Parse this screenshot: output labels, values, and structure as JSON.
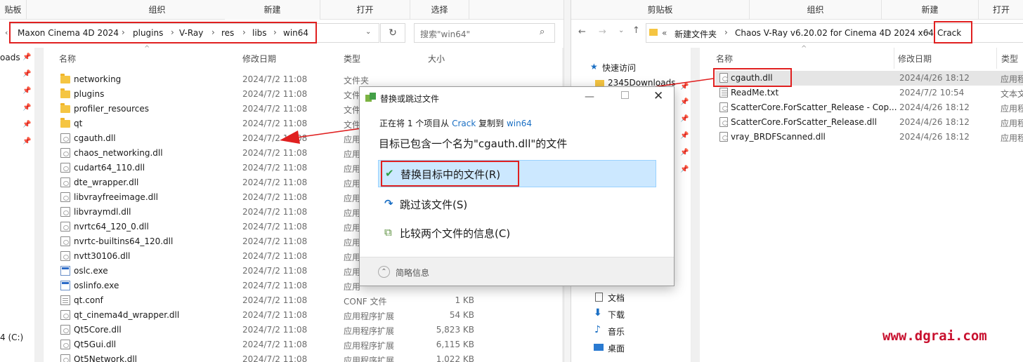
{
  "left": {
    "ribbon": [
      "贴板",
      "组织",
      "新建",
      "打开",
      "选择"
    ],
    "path": [
      "Maxon Cinema 4D 2024",
      "plugins",
      "V-Ray",
      "res",
      "libs",
      "win64"
    ],
    "search_placeholder": "搜索\"win64\"",
    "columns": {
      "name": "名称",
      "date": "修改日期",
      "type": "类型",
      "size": "大小"
    },
    "nav": {
      "downloads": "oads",
      "drive": "4 (C:)"
    },
    "files": [
      {
        "name": "networking",
        "date": "2024/7/2 11:08",
        "type": "文件夹",
        "size": "",
        "icon": "folder"
      },
      {
        "name": "plugins",
        "date": "2024/7/2 11:08",
        "type": "文件",
        "size": "",
        "icon": "folder"
      },
      {
        "name": "profiler_resources",
        "date": "2024/7/2 11:08",
        "type": "文件",
        "size": "",
        "icon": "folder"
      },
      {
        "name": "qt",
        "date": "2024/7/2 11:08",
        "type": "文件",
        "size": "",
        "icon": "folder"
      },
      {
        "name": "cgauth.dll",
        "date": "2024/7/2 11:08",
        "type": "应用",
        "size": "",
        "icon": "dll"
      },
      {
        "name": "chaos_networking.dll",
        "date": "2024/7/2 11:08",
        "type": "应用",
        "size": "",
        "icon": "dll"
      },
      {
        "name": "cudart64_110.dll",
        "date": "2024/7/2 11:08",
        "type": "应用",
        "size": "",
        "icon": "dll"
      },
      {
        "name": "dte_wrapper.dll",
        "date": "2024/7/2 11:08",
        "type": "应用",
        "size": "",
        "icon": "dll"
      },
      {
        "name": "libvrayfreeimage.dll",
        "date": "2024/7/2 11:08",
        "type": "应用",
        "size": "",
        "icon": "dll"
      },
      {
        "name": "libvraymdl.dll",
        "date": "2024/7/2 11:08",
        "type": "应用",
        "size": "",
        "icon": "dll"
      },
      {
        "name": "nvrtc64_120_0.dll",
        "date": "2024/7/2 11:08",
        "type": "应用",
        "size": "",
        "icon": "dll"
      },
      {
        "name": "nvrtc-builtins64_120.dll",
        "date": "2024/7/2 11:08",
        "type": "应用",
        "size": "",
        "icon": "dll"
      },
      {
        "name": "nvtt30106.dll",
        "date": "2024/7/2 11:08",
        "type": "应用",
        "size": "",
        "icon": "dll"
      },
      {
        "name": "oslc.exe",
        "date": "2024/7/2 11:08",
        "type": "应用",
        "size": "",
        "icon": "exe"
      },
      {
        "name": "oslinfo.exe",
        "date": "2024/7/2 11:08",
        "type": "应用",
        "size": "",
        "icon": "exe"
      },
      {
        "name": "qt.conf",
        "date": "2024/7/2 11:08",
        "type": "CONF 文件",
        "size": "1 KB",
        "icon": "txt"
      },
      {
        "name": "qt_cinema4d_wrapper.dll",
        "date": "2024/7/2 11:08",
        "type": "应用程序扩展",
        "size": "54 KB",
        "icon": "dll"
      },
      {
        "name": "Qt5Core.dll",
        "date": "2024/7/2 11:08",
        "type": "应用程序扩展",
        "size": "5,823 KB",
        "icon": "dll"
      },
      {
        "name": "Qt5Gui.dll",
        "date": "2024/7/2 11:08",
        "type": "应用程序扩展",
        "size": "6,115 KB",
        "icon": "dll"
      },
      {
        "name": "Qt5Network.dll",
        "date": "2024/7/2 11:08",
        "type": "应用程序扩展",
        "size": "1,022 KB",
        "icon": "dll"
      }
    ]
  },
  "right": {
    "ribbon": [
      "剪贴板",
      "组织",
      "新建",
      "打开"
    ],
    "path_prefix": "«",
    "path": [
      "新建文件夹",
      "Chaos V-Ray v6.20.02 for Cinema 4D 2024 x64",
      "Crack"
    ],
    "columns": {
      "name": "名称",
      "date": "修改日期",
      "type": "类型"
    },
    "nav": {
      "quick_access": "快速访问",
      "downloads_folder": "2345Downloads",
      "documents": "文档",
      "downloads": "下载",
      "music": "音乐",
      "desktop": "桌面"
    },
    "files": [
      {
        "name": "cgauth.dll",
        "date": "2024/4/26 18:12",
        "type": "应用程",
        "icon": "dll"
      },
      {
        "name": "ReadMe.txt",
        "date": "2024/7/2 10:54",
        "type": "文本文",
        "icon": "txt"
      },
      {
        "name": "ScatterCore.ForScatter_Release - Cop...",
        "date": "2024/4/26 18:12",
        "type": "应用程",
        "icon": "dll"
      },
      {
        "name": "ScatterCore.ForScatter_Release.dll",
        "date": "2024/4/26 18:12",
        "type": "应用程",
        "icon": "dll"
      },
      {
        "name": "vray_BRDFScanned.dll",
        "date": "2024/4/26 18:12",
        "type": "应用程",
        "icon": "dll"
      }
    ]
  },
  "dialog": {
    "title": "替换或跳过文件",
    "info_prefix": "正在将 1 个项目从",
    "info_from": "Crack",
    "info_mid": "复制到",
    "info_to": "win64",
    "heading": "目标已包含一个名为\"cgauth.dll\"的文件",
    "options": [
      "替换目标中的文件(R)",
      "跳过该文件(S)",
      "比较两个文件的信息(C)"
    ],
    "footer": "简略信息"
  },
  "watermark": "www.dgrai.com",
  "colors": {
    "accent": "#1a6fc4",
    "annotation_red": "#e02020",
    "selection": "#cce8ff",
    "watermark": "#c8102e"
  }
}
